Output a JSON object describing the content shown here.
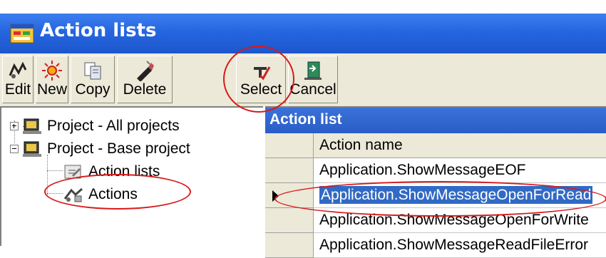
{
  "window": {
    "title": "Action lists",
    "icon": "app-window-icon"
  },
  "toolbar": {
    "buttons": [
      {
        "label": "Edit",
        "icon": "edit-icon"
      },
      {
        "label": "New",
        "icon": "new-icon"
      },
      {
        "label": "Copy",
        "icon": "copy-icon"
      },
      {
        "label": "Delete",
        "icon": "delete-icon"
      },
      {
        "label": "Select",
        "icon": "select-icon"
      },
      {
        "label": "Cancel",
        "icon": "exit-icon"
      }
    ]
  },
  "tree": {
    "nodes": [
      {
        "label": "Project - All projects",
        "expander": "+",
        "icon": "project-icon"
      },
      {
        "label": "Project - Base project",
        "expander": "-",
        "icon": "project-icon"
      },
      {
        "label": "Action lists",
        "icon": "action-lists-icon"
      },
      {
        "label": "Actions",
        "icon": "actions-icon"
      }
    ]
  },
  "grid": {
    "title": "Action list",
    "column_header": "Action name",
    "rows": [
      "Application.ShowMessageEOF",
      "Application.ShowMessageOpenForRead",
      "Application.ShowMessageOpenForWrite",
      "Application.ShowMessageReadFileError"
    ],
    "selected_row": 1
  },
  "colors": {
    "titlebar": "#2566e0",
    "grid_title": "#2a5cc8",
    "selection": "#316ac5",
    "annotation": "#d81a1a"
  }
}
